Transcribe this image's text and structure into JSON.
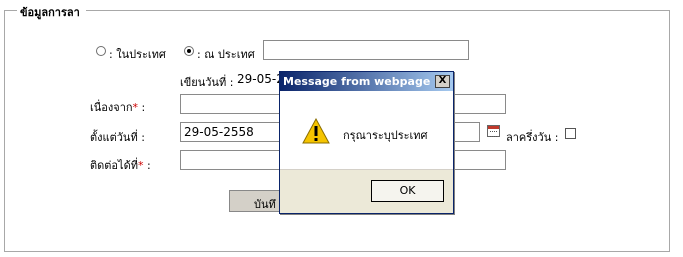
{
  "form": {
    "legend": "ข้อมูลการลา",
    "radio_domestic": ": ในประเทศ",
    "radio_abroad": ": ณ ประเทศ",
    "abroad_value": "",
    "written_date_label": "เขียนวันที่ :",
    "written_date_value": "29-05-2",
    "reason_label": "เนื่องจาก",
    "reason_value": "",
    "start_date_label": "ตั้งแต่วันที่ :",
    "start_date_value": "29-05-2558",
    "half_day_label": "ลาครึ่งวัน :",
    "contact_label": "ติดต่อได้ที่",
    "contact_value": "",
    "required_mark": "*",
    "colon": " :",
    "save_label": "บันทึ"
  },
  "dialog": {
    "title": "Message from webpage",
    "close_label": "X",
    "message": "กรุณาระบุประเทศ",
    "ok_label": "OK"
  }
}
